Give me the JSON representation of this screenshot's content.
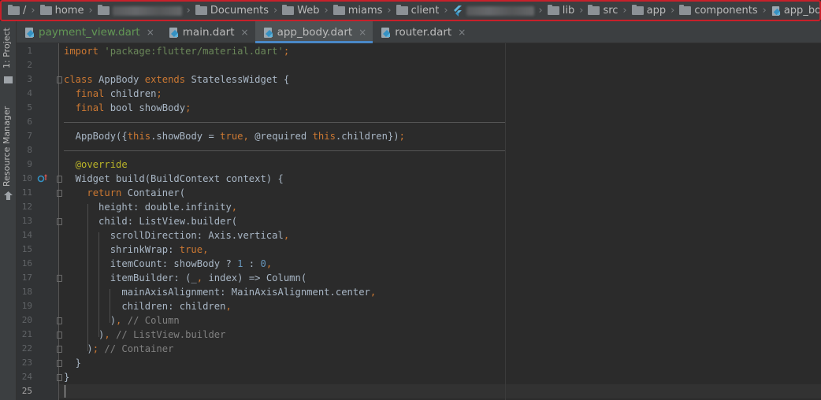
{
  "breadcrumb": {
    "segments": [
      {
        "label": "/",
        "icon": "folder-icon"
      },
      {
        "label": "home",
        "icon": "folder-icon"
      },
      {
        "label": "",
        "icon": "folder-icon",
        "redacted": true
      },
      {
        "label": "Documents",
        "icon": "folder-icon"
      },
      {
        "label": "Web",
        "icon": "folder-icon"
      },
      {
        "label": "miams",
        "icon": "folder-icon"
      },
      {
        "label": "client",
        "icon": "folder-icon"
      },
      {
        "label": "",
        "icon": "flutter-icon",
        "redacted": true
      },
      {
        "label": "lib",
        "icon": "folder-icon"
      },
      {
        "label": "src",
        "icon": "folder-icon"
      },
      {
        "label": "app",
        "icon": "folder-icon"
      },
      {
        "label": "components",
        "icon": "folder-icon"
      },
      {
        "label": "app_body.dart",
        "icon": "dart-file-icon"
      }
    ]
  },
  "tool_windows": {
    "project": "1: Project",
    "resource_manager": "Resource Manager"
  },
  "tabs": [
    {
      "label": "payment_view.dart",
      "modified": true,
      "active": false
    },
    {
      "label": "main.dart",
      "modified": false,
      "active": false
    },
    {
      "label": "app_body.dart",
      "modified": false,
      "active": true
    },
    {
      "label": "router.dart",
      "modified": false,
      "active": false
    }
  ],
  "tab_close_glyph": "×",
  "editor": {
    "current_line": 25,
    "lines": [
      {
        "n": "1",
        "tokens": [
          [
            "kw",
            "import "
          ],
          [
            "str",
            "'package:flutter/material.dart'"
          ],
          [
            "kw",
            ";"
          ]
        ]
      },
      {
        "n": "2",
        "tokens": []
      },
      {
        "n": "3",
        "tokens": [
          [
            "kw",
            "class "
          ],
          [
            "",
            "AppBody "
          ],
          [
            "kw",
            "extends "
          ],
          [
            "",
            "StatelessWidget {"
          ]
        ]
      },
      {
        "n": "4",
        "tokens": [
          [
            "",
            "  "
          ],
          [
            "kw",
            "final "
          ],
          [
            "",
            "children"
          ],
          [
            "kw",
            ";"
          ]
        ]
      },
      {
        "n": "5",
        "tokens": [
          [
            "",
            "  "
          ],
          [
            "kw",
            "final "
          ],
          [
            "",
            "bool showBody"
          ],
          [
            "kw",
            ";"
          ]
        ]
      },
      {
        "n": "6",
        "tokens": []
      },
      {
        "n": "7",
        "tokens": [
          [
            "",
            "  AppBody({"
          ],
          [
            "kw",
            "this"
          ],
          [
            "",
            ".showBody = "
          ],
          [
            "kw",
            "true"
          ],
          [
            "kw",
            ", "
          ],
          [
            "",
            "@required "
          ],
          [
            "kw",
            "this"
          ],
          [
            "",
            ".children})"
          ],
          [
            "kw",
            ";"
          ]
        ]
      },
      {
        "n": "8",
        "tokens": []
      },
      {
        "n": "9",
        "tokens": [
          [
            "ann",
            "  @override"
          ]
        ]
      },
      {
        "n": "10",
        "tokens": [
          [
            "",
            "  Widget build(BuildContext context) {"
          ]
        ]
      },
      {
        "n": "11",
        "tokens": [
          [
            "",
            "    "
          ],
          [
            "kw",
            "return "
          ],
          [
            "",
            "Container("
          ]
        ]
      },
      {
        "n": "12",
        "tokens": [
          [
            "",
            "      height: double.infinity"
          ],
          [
            "kw",
            ","
          ]
        ]
      },
      {
        "n": "13",
        "tokens": [
          [
            "",
            "      child: ListView.builder("
          ]
        ]
      },
      {
        "n": "14",
        "tokens": [
          [
            "",
            "        scrollDirection: Axis.vertical"
          ],
          [
            "kw",
            ","
          ]
        ]
      },
      {
        "n": "15",
        "tokens": [
          [
            "",
            "        shrinkWrap: "
          ],
          [
            "kw",
            "true,"
          ]
        ]
      },
      {
        "n": "16",
        "tokens": [
          [
            "",
            "        itemCount: showBody ? "
          ],
          [
            "num",
            "1"
          ],
          [
            "",
            " : "
          ],
          [
            "num",
            "0"
          ],
          [
            "kw",
            ","
          ]
        ]
      },
      {
        "n": "17",
        "tokens": [
          [
            "",
            "        itemBuilder: (_"
          ],
          [
            "kw",
            ", "
          ],
          [
            "",
            "index) => Column("
          ]
        ]
      },
      {
        "n": "18",
        "tokens": [
          [
            "",
            "          mainAxisAlignment: MainAxisAlignment.center"
          ],
          [
            "kw",
            ","
          ]
        ]
      },
      {
        "n": "19",
        "tokens": [
          [
            "",
            "          children: children"
          ],
          [
            "kw",
            ","
          ]
        ]
      },
      {
        "n": "20",
        "tokens": [
          [
            "",
            "        )"
          ],
          [
            "kw",
            ", "
          ],
          [
            "cm",
            "// Column"
          ]
        ]
      },
      {
        "n": "21",
        "tokens": [
          [
            "",
            "      )"
          ],
          [
            "kw",
            ", "
          ],
          [
            "cm",
            "// ListView.builder"
          ]
        ]
      },
      {
        "n": "22",
        "tokens": [
          [
            "",
            "    )"
          ],
          [
            "kw",
            "; "
          ],
          [
            "cm",
            "// Container"
          ]
        ]
      },
      {
        "n": "23",
        "tokens": [
          [
            "",
            "  }"
          ]
        ]
      },
      {
        "n": "24",
        "tokens": [
          [
            "",
            "}"
          ]
        ]
      },
      {
        "n": "25",
        "tokens": []
      }
    ]
  },
  "colors": {
    "keyword": "#cc7832",
    "string": "#6a8759",
    "number": "#6897bb",
    "comment": "#808080",
    "annotation": "#bbb529",
    "identifier": "#a9b7c6",
    "modified_tab": "#629755",
    "active_tab_underline": "#4a88c7",
    "highlight_border": "#c8202a"
  }
}
